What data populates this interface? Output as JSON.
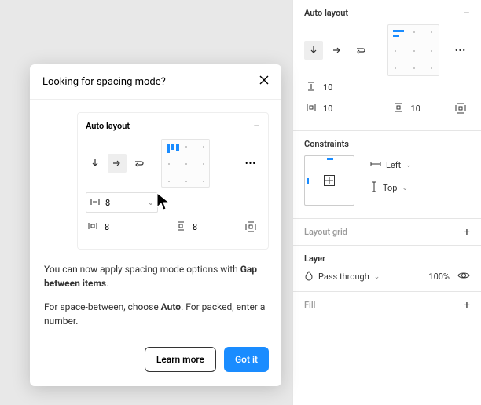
{
  "inspector": {
    "autolayout": {
      "title": "Auto layout",
      "gap": "10",
      "padH": "10",
      "padV": "10"
    },
    "constraints": {
      "title": "Constraints",
      "h": "Left",
      "v": "Top"
    },
    "layoutGrid": {
      "title": "Layout grid"
    },
    "layer": {
      "title": "Layer",
      "mode": "Pass through",
      "opacity": "100%"
    },
    "fill": {
      "title": "Fill"
    }
  },
  "modal": {
    "title": "Looking for spacing mode?",
    "mini": {
      "title": "Auto layout",
      "gapVal": "8",
      "padH": "8",
      "padV": "8"
    },
    "body1a": "You can now apply spacing mode options with ",
    "body1b": "Gap between items",
    "body1c": ".",
    "body2a": "For space-between, choose ",
    "body2b": "Auto",
    "body2c": ". For packed, enter a number.",
    "learn": "Learn more",
    "gotit": "Got it"
  }
}
